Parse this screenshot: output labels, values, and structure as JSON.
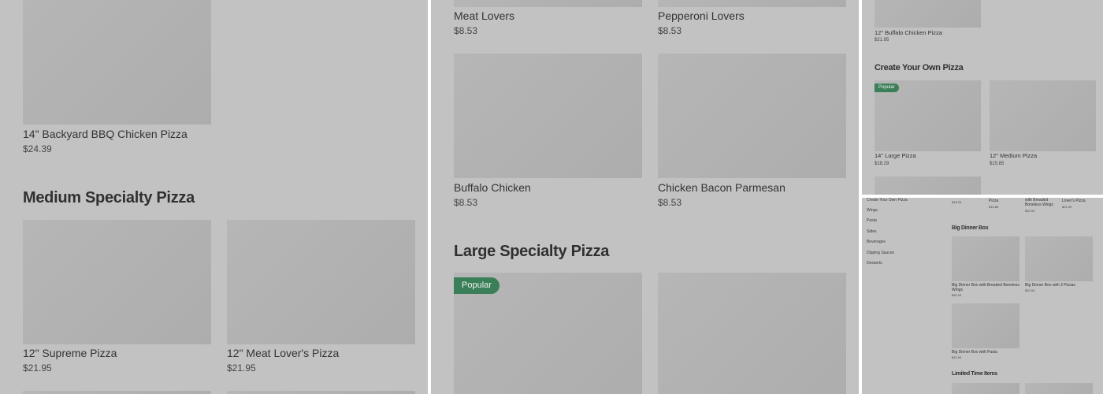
{
  "panel1": {
    "items": [
      {
        "name": "14\" Backyard BBQ Chicken Pizza",
        "price": "$24.39"
      },
      {
        "name": "12\" Supreme Pizza",
        "price": "$21.95"
      },
      {
        "name": "12\" Meat Lover's Pizza",
        "price": "$21.95"
      }
    ],
    "section_heading": "Medium Specialty Pizza"
  },
  "panel2": {
    "items": [
      {
        "name": "Meat Lovers",
        "price": "$8.53"
      },
      {
        "name": "Pepperoni Lovers",
        "price": "$8.53"
      },
      {
        "name": "Buffalo Chicken",
        "price": "$8.53"
      },
      {
        "name": "Chicken Bacon Parmesan",
        "price": "$8.53"
      }
    ],
    "section_heading": "Large Specialty Pizza",
    "badge": "Popular"
  },
  "panel3": {
    "items": [
      {
        "name": "12\" Buffalo Chicken Pizza",
        "price": "$21.95"
      },
      {
        "name": "14\" Large Pizza",
        "price": "$18.29"
      },
      {
        "name": "12\" Medium Pizza",
        "price": "$15.85"
      }
    ],
    "section_heading": "Create Your Own Pizza",
    "badge": "Popular"
  },
  "panel4": {
    "nav": [
      "Create Your Own Pizza",
      "Wings",
      "Pasta",
      "Sides",
      "Beverages",
      "Dipping Sauces",
      "Desserts"
    ],
    "top_fragments": [
      {
        "price": "$18.29"
      },
      {
        "name": "Pizza",
        "price": "$15.85"
      },
      {
        "name": "with Breaded Boneless Wings",
        "price": "$32.93"
      },
      {
        "name": "Lover's Pizza",
        "price": "$21.95"
      }
    ],
    "section_heading": "Big Dinner Box",
    "items": [
      {
        "name": "Big Dinner Box with Breaded Boneless Wings",
        "price": "$32.93"
      },
      {
        "name": "Big Dinner Box with 3 Pizzas",
        "price": "$32.94"
      },
      {
        "name": "Big Dinner Box with Pasta",
        "price": "$32.93"
      }
    ],
    "section_heading_2": "Limited Time Items"
  }
}
